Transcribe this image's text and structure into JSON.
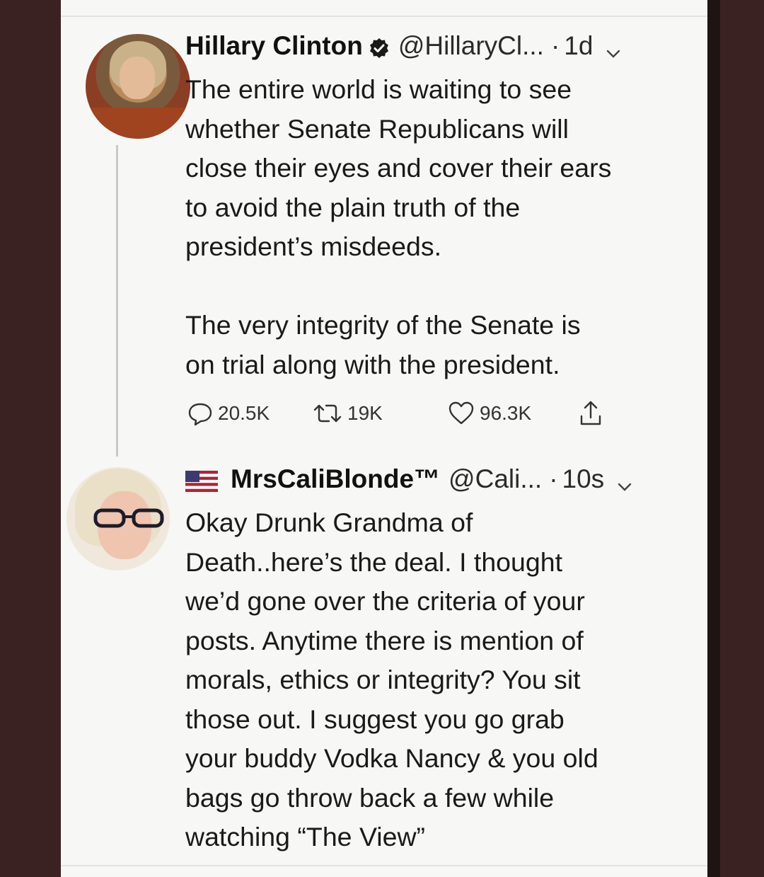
{
  "tweets": [
    {
      "author_name": "Hillary Clinton",
      "handle": "@HillaryCl...",
      "separator": "·",
      "time": "1d",
      "body": "The entire world is waiting to see\nwhether Senate Republicans will\nclose their eyes and cover their ears\nto avoid the plain truth of the\npresident’s misdeeds.\n\nThe very integrity of the Senate is\non trial along with the president.",
      "stats": {
        "replies": "20.5K",
        "retweets": "19K",
        "likes": "96.3K"
      }
    },
    {
      "author_name": "MrsCaliBlonde™",
      "handle": "@Cali...",
      "separator": "·",
      "time": "10s",
      "body": "Okay Drunk Grandma of\nDeath..here’s the deal. I thought\nwe’d gone over the criteria of your\nposts. Anytime there is mention of\nmorals, ethics or integrity? You sit\nthose out. I suggest you go grab\nyour buddy Vodka Nancy & you old\nbags go throw back a few while\nwatching “The View”"
    }
  ],
  "colors": {
    "background": "#3b2222",
    "card": "#f7f7f6",
    "verified_badge": "#1a1a1a"
  },
  "icons": [
    "verified-icon",
    "chevron-down-icon",
    "reply-icon",
    "retweet-icon",
    "like-icon",
    "share-icon",
    "us-flag-icon"
  ]
}
